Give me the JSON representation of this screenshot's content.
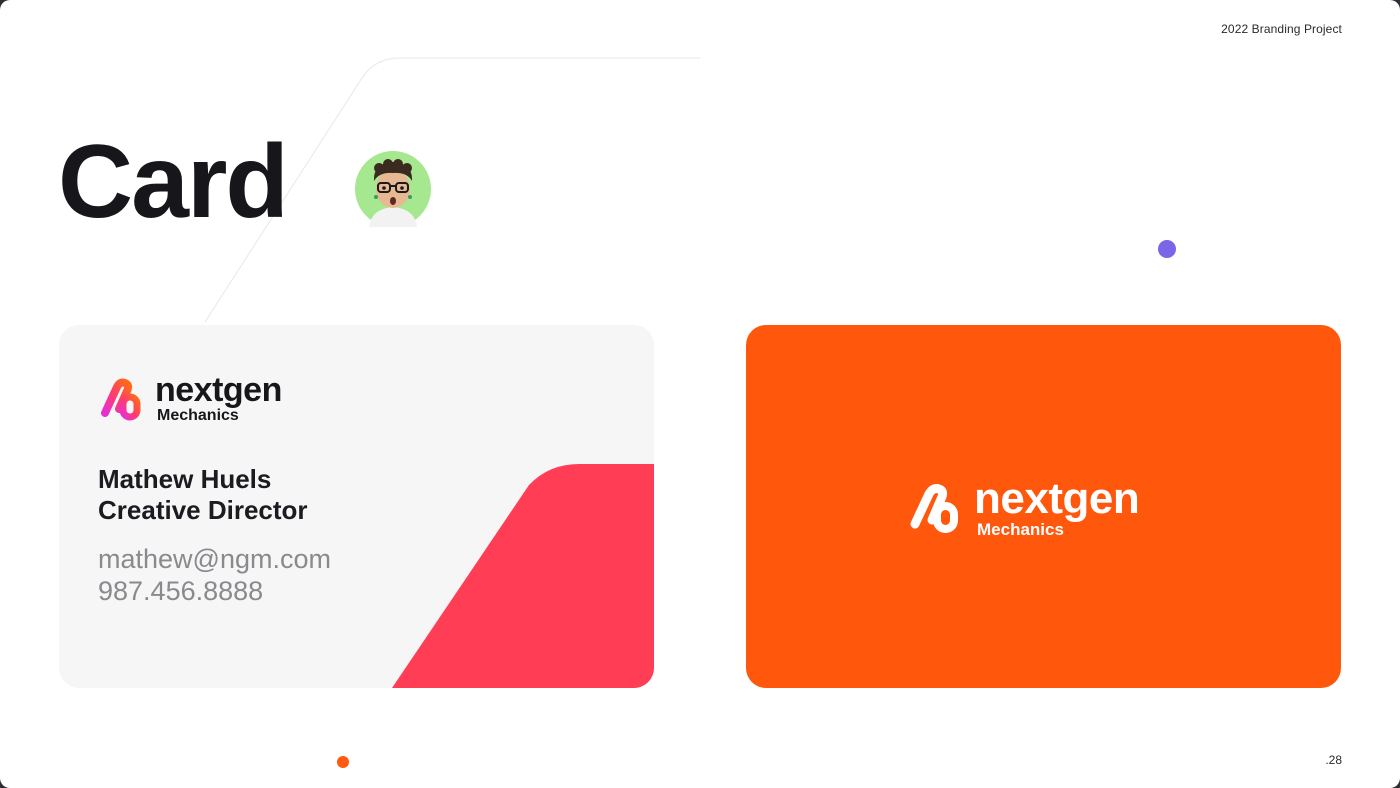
{
  "header": {
    "project_label": "2022 Branding Project"
  },
  "slide": {
    "title": "Card",
    "page_number": ".28"
  },
  "colors": {
    "accent_orange": "#ff570c",
    "accent_red": "#ff3d54",
    "accent_purple": "#7c66e8",
    "card_front_bg": "#f6f6f7"
  },
  "avatar": {
    "icon": "memoji-avatar-icon"
  },
  "brand": {
    "name": "nextgen",
    "subtitle": "Mechanics",
    "icon": "nextgen-link-logo-icon"
  },
  "business_card": {
    "name": "Mathew Huels",
    "role": "Creative Director",
    "email": "mathew@ngm.com",
    "phone": "987.456.8888"
  }
}
